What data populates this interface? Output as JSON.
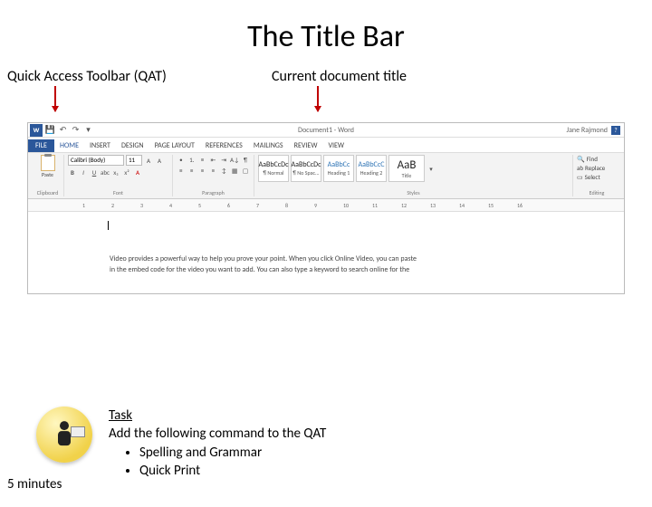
{
  "slide": {
    "title": "The Title Bar",
    "anno_left": "Quick Access Toolbar (QAT)",
    "anno_right": "Current document title"
  },
  "word": {
    "doc_title": "Document1 - Word",
    "user_name": "Jane Rajmond",
    "qat": {
      "save": "💾",
      "undo": "↶",
      "redo": "↷"
    },
    "tabs": {
      "file": "FILE",
      "home": "HOME",
      "insert": "INSERT",
      "design": "DESIGN",
      "page_layout": "PAGE LAYOUT",
      "references": "REFERENCES",
      "mailings": "MAILINGS",
      "review": "REVIEW",
      "view": "VIEW"
    },
    "ribbon": {
      "clipboard": {
        "paste": "Paste",
        "label": "Clipboard"
      },
      "font": {
        "name": "Calibri (Body)",
        "size": "11",
        "label": "Font"
      },
      "paragraph": {
        "label": "Paragraph"
      },
      "styles": {
        "label": "Styles",
        "items": [
          {
            "sample": "AaBbCcDc",
            "name": "¶ Normal"
          },
          {
            "sample": "AaBbCcDc",
            "name": "¶ No Spac..."
          },
          {
            "sample": "AaBbCc",
            "name": "Heading 1"
          },
          {
            "sample": "AaBbCcC",
            "name": "Heading 2"
          },
          {
            "sample": "AaB",
            "name": "Title"
          }
        ]
      },
      "editing": {
        "find": "Find",
        "replace": "Replace",
        "select": "Select",
        "label": "Editing"
      }
    },
    "ruler": [
      "1",
      "2",
      "3",
      "4",
      "5",
      "6",
      "7",
      "8",
      "9",
      "10",
      "11",
      "12",
      "13",
      "14",
      "15",
      "16"
    ],
    "body": {
      "line1": "Video provides a powerful way to help you prove your point. When you click Online Video, you can paste",
      "line2": "in the embed code for the video you want to add. You can also type a keyword to search online for the"
    }
  },
  "task": {
    "heading": "Task",
    "intro": "Add the following command to the QAT",
    "items": [
      "Spelling and Grammar",
      "Quick Print"
    ],
    "duration": "5 minutes"
  }
}
